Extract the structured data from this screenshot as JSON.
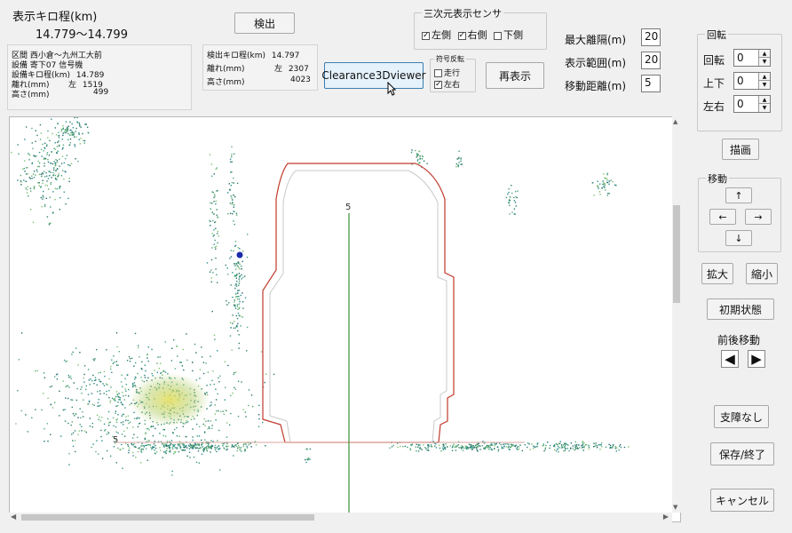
{
  "display_km": {
    "label": "表示キロ程(km)",
    "range": "14.779〜14.799"
  },
  "detect_button": "検出",
  "info_left": {
    "section_label": "区間",
    "section_value": "西小倉〜九州工大前",
    "equip_label": "設備",
    "equip_value": "寄下07 信号機",
    "equip_km_label": "設備キロ程(km)",
    "equip_km_value": "14.789",
    "distance_label": "離れ(mm)",
    "distance_side": "左",
    "distance_value": "1519",
    "height_label": "高さ(mm)",
    "height_value": "499"
  },
  "info_mid": {
    "detect_km_label": "検出キロ程(km)",
    "detect_km_value": "14.797",
    "distance_label": "離れ(mm)",
    "distance_side": "左",
    "distance_value": "2307",
    "height_label": "高さ(mm)",
    "height_value": "4023"
  },
  "clearance_button": "Clearance3Dviewer",
  "sign_flip": {
    "title": "符号反転",
    "options": [
      {
        "label": "走行",
        "checked": false
      },
      {
        "label": "左右",
        "checked": true
      }
    ]
  },
  "redisplay_button": "再表示",
  "sensor_group": {
    "title": "三次元表示センサ",
    "options": [
      {
        "label": "左側",
        "checked": true
      },
      {
        "label": "右側",
        "checked": true
      },
      {
        "label": "下側",
        "checked": false
      }
    ]
  },
  "params": [
    {
      "label": "最大離隔(m)",
      "value": "20"
    },
    {
      "label": "表示範囲(m)",
      "value": "20"
    },
    {
      "label": "移動距離(m)",
      "value": "5"
    }
  ],
  "rotation_group": {
    "title": "回転",
    "spinners": [
      {
        "label": "回転",
        "value": "0"
      },
      {
        "label": "上下",
        "value": "0"
      },
      {
        "label": "左右",
        "value": "0"
      }
    ]
  },
  "draw_button": "描画",
  "move_group": {
    "title": "移動",
    "up": "↑",
    "left": "←",
    "right": "→",
    "down": "↓"
  },
  "zoom_in_button": "拡大",
  "zoom_out_button": "縮小",
  "initial_state_button": "初期状態",
  "front_back_label": "前後移動",
  "prev_arrow": "◀",
  "next_arrow": "▶",
  "support_button": "支障なし",
  "save_exit_button": "保存/終了",
  "cancel_button": "キャンセル",
  "viewer": {
    "label_top": "5",
    "label_left": "5"
  },
  "colors": {
    "profile_line": "#c0392b",
    "center_line": "#3a8f3a",
    "marker": "#1a2aa8"
  }
}
